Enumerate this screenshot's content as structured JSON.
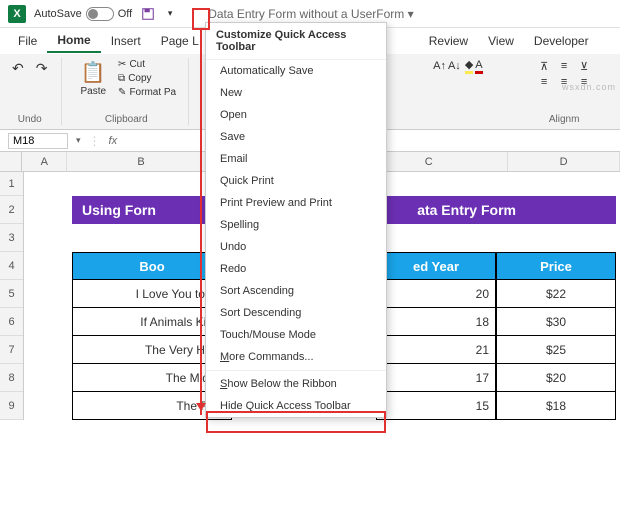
{
  "titlebar": {
    "autosave_label": "AutoSave",
    "autosave_state": "Off",
    "doc_title": "Data Entry Form without a UserForm ▾"
  },
  "menubar": {
    "items": [
      "File",
      "Home",
      "Insert",
      "Page L",
      "Review",
      "View",
      "Developer"
    ]
  },
  "ribbon": {
    "undo_label": "Undo",
    "paste_label": "Paste",
    "cut_label": "Cut",
    "copy_label": "Copy",
    "formatp_label": "Format Pa",
    "clipboard_label": "Clipboard",
    "alignment_label": "Alignm"
  },
  "namebox": {
    "value": "M18",
    "fx": "fx"
  },
  "columns": [
    "A",
    "B",
    "C",
    "D"
  ],
  "rows": [
    "1",
    "2",
    "3",
    "4",
    "5",
    "6",
    "7",
    "8",
    "9"
  ],
  "banner": {
    "left_text": "Using Forn",
    "right_text": "ata Entry Form"
  },
  "table": {
    "headers": {
      "book": "Boo",
      "year": "ed Year",
      "price": "Price"
    },
    "rows": [
      {
        "book": "I Love You to the",
        "year": "20",
        "price": "$22"
      },
      {
        "book": "If Animals Kisse",
        "year": "18",
        "price": "$30"
      },
      {
        "book": "The Very Hung",
        "year": "21",
        "price": "$25"
      },
      {
        "book": "The Midnig",
        "year": "17",
        "price": "$20"
      },
      {
        "book": "The Four",
        "year": "15",
        "price": "$18"
      }
    ]
  },
  "menu_popup": {
    "title": "Customize Quick Access Toolbar",
    "items": [
      "Automatically Save",
      "New",
      "Open",
      "Save",
      "Email",
      "Quick Print",
      "Print Preview and Print",
      "Spelling",
      "Undo",
      "Redo",
      "Sort Ascending",
      "Sort Descending",
      "Touch/Mouse Mode"
    ],
    "more_commands_prefix": "M",
    "more_commands_rest": "ore Commands...",
    "show_below_prefix": "S",
    "show_below_rest": "how Below the Ribbon",
    "hide_qat": "Hide Quick Access Toolbar"
  },
  "watermark": "wsxdn.com"
}
